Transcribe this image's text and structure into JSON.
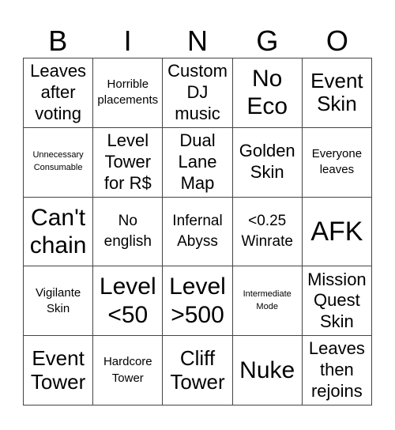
{
  "header": {
    "letters": [
      "B",
      "I",
      "N",
      "G",
      "O"
    ]
  },
  "cells": [
    [
      "Leaves after voting",
      "Horrible placements",
      "Custom DJ music",
      "No Eco",
      "Event Skin"
    ],
    [
      "Unnecessary Consumable",
      "Level Tower for R$",
      "Dual Lane Map",
      "Golden Skin",
      "Everyone leaves"
    ],
    [
      "Can't chain",
      "No english",
      "Infernal Abyss",
      "<0.25 Winrate",
      "AFK"
    ],
    [
      "Vigilante Skin",
      "Level <50",
      "Level >500",
      "Intermediate Mode",
      "Mission Quest Skin"
    ],
    [
      "Event Tower",
      "Hardcore Tower",
      "Cliff Tower",
      "Nuke",
      "Leaves then rejoins"
    ]
  ]
}
